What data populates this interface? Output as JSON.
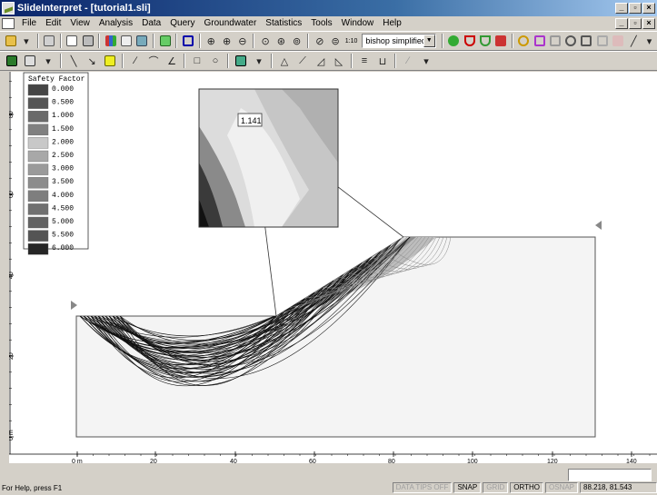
{
  "window": {
    "title": "SlideInterpret - [tutorial1.sli]",
    "controls": [
      "_",
      "□",
      "X"
    ]
  },
  "menu": [
    "File",
    "Edit",
    "View",
    "Analysis",
    "Data",
    "Query",
    "Groundwater",
    "Statistics",
    "Tools",
    "Window",
    "Help"
  ],
  "toolbar1": {
    "method_select": "bishop simplified",
    "scale_label": "1:10"
  },
  "legend": {
    "title": "Safety Factor",
    "values": [
      "0.000",
      "0.500",
      "1.000",
      "1.500",
      "2.000",
      "2.500",
      "3.000",
      "3.500",
      "4.000",
      "4.500",
      "5.000",
      "5.500",
      "6.000"
    ],
    "colors": [
      "#454545",
      "#555555",
      "#6a6a6a",
      "#808080",
      "#c8c8c8",
      "#a8a8a8",
      "#9a9a9a",
      "#8c8c8c",
      "#7e7e7e",
      "#707070",
      "#626262",
      "#545454",
      "#262626"
    ]
  },
  "zoom": {
    "min_fs_label": "1.141"
  },
  "axes": {
    "x_ticks": [
      "0 m",
      "20",
      "40",
      "60",
      "80",
      "100",
      "120",
      "140"
    ],
    "y_ticks": [
      "0 m",
      "20",
      "40",
      "60",
      "80"
    ]
  },
  "status": {
    "help": "For Help, press F1",
    "data_tips": "DATA TIPS OFF",
    "snap": "SNAP",
    "grid": "GRID",
    "ortho": "ORTHO",
    "osnap": "OSNAP",
    "coords": "88.218, 81.543"
  }
}
